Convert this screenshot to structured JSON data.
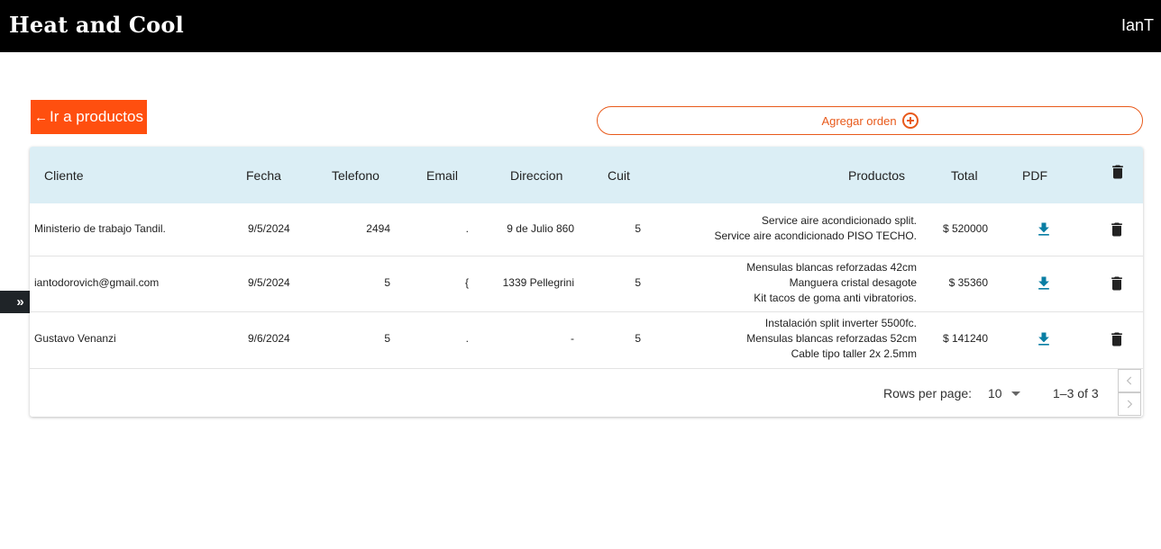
{
  "header": {
    "title": "Heat and Cool",
    "user": "IanT"
  },
  "actions": {
    "back_label": "Ir a productos",
    "add_label": "Agregar orden"
  },
  "table": {
    "columns": [
      "Cliente",
      "Fecha",
      "Telefono",
      "Email",
      "Direccion",
      "Cuit",
      "Productos",
      "Total",
      "PDF"
    ],
    "rows": [
      {
        "cliente": "Ministerio de trabajo Tandil.",
        "fecha": "9/5/2024",
        "telefono": "2494",
        "email": ".",
        "direccion": "9 de Julio 860",
        "cuit": "5",
        "productos": [
          "Service aire acondicionado split.",
          "Service aire acondicionado PISO TECHO."
        ],
        "total": "$ 520000"
      },
      {
        "cliente": "iantodorovich@gmail.com",
        "fecha": "9/5/2024",
        "telefono": "5",
        "email": "{",
        "direccion": "1339 Pellegrini",
        "cuit": "5",
        "productos": [
          "Mensulas blancas reforzadas 42cm",
          "Manguera cristal desagote",
          "Kit tacos de goma anti vibratorios."
        ],
        "total": "$ 35360"
      },
      {
        "cliente": "Gustavo Venanzi",
        "fecha": "9/6/2024",
        "telefono": "5",
        "email": ".",
        "direccion": "-",
        "cuit": "5",
        "productos": [
          "Instalación split inverter 5500fc.",
          "Mensulas blancas reforzadas 52cm",
          "Cable tipo taller 2x 2.5mm"
        ],
        "total": "$ 141240"
      }
    ]
  },
  "pagination": {
    "rows_per_page_label": "Rows per page:",
    "rows_per_page_value": "10",
    "range": "1–3 of 3"
  },
  "colors": {
    "accent": "#ff4f0f",
    "header_bg": "#dbeef5",
    "download": "#0a7ea4",
    "topbar": "#000000"
  },
  "icons": {
    "back": "arrow-left-icon",
    "add": "plus-circle-icon",
    "download": "download-icon",
    "delete": "trash-icon",
    "sidebar": "double-chevron-right-icon"
  }
}
